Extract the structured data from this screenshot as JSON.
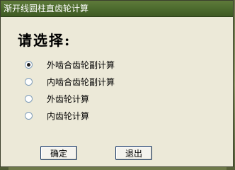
{
  "window": {
    "title": "渐开线圆柱直齿轮计算"
  },
  "prompt": "请选择:",
  "options": [
    {
      "label": "外啮合齿轮副计算",
      "checked": true
    },
    {
      "label": "内啮合齿轮副计算",
      "checked": false
    },
    {
      "label": "外齿轮计算",
      "checked": false
    },
    {
      "label": "内齿轮计算",
      "checked": false
    }
  ],
  "buttons": {
    "ok_label": "确定",
    "exit_label": "退出"
  }
}
